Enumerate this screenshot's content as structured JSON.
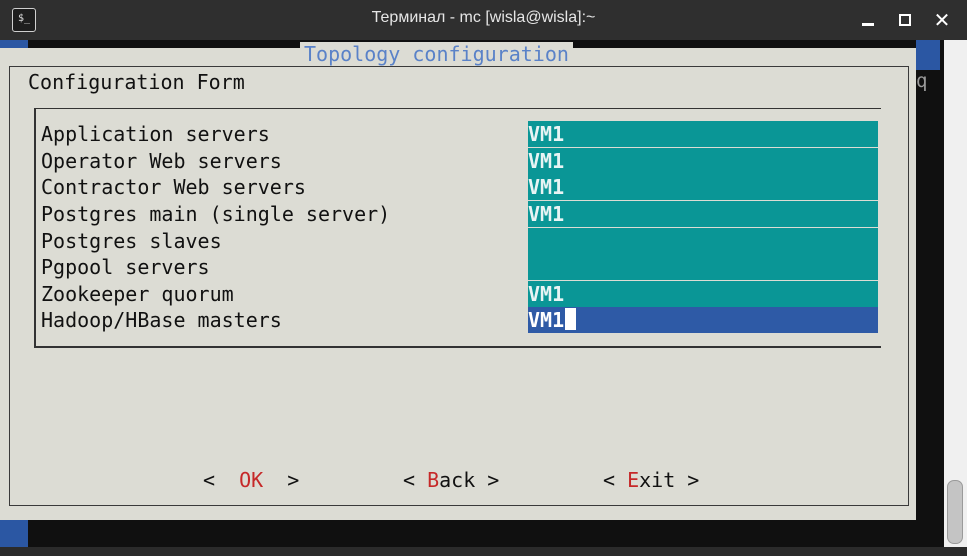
{
  "window": {
    "title": "Терминал - mc [wisla@wisla]:~",
    "icon": "terminal-icon",
    "controls": [
      "minimize-icon",
      "maximize-icon",
      "close-icon"
    ],
    "close_glyph": "✕"
  },
  "terminal": {
    "edge_char": "q"
  },
  "dialog": {
    "title": "Topology configuration",
    "heading": "Configuration Form",
    "fields": [
      {
        "label": "Application servers",
        "value": "VM1"
      },
      {
        "label": "Operator Web servers",
        "value": "VM1"
      },
      {
        "label": "Contractor Web servers",
        "value": "VM1"
      },
      {
        "label": "Postgres main (single server)",
        "value": "VM1"
      },
      {
        "label": "Postgres slaves",
        "value": ""
      },
      {
        "label": "Pgpool servers",
        "value": ""
      },
      {
        "label": "Zookeeper quorum",
        "value": "VM1"
      },
      {
        "label": "Hadoop/HBase masters",
        "value": "VM1"
      }
    ],
    "active_field_index": 7,
    "buttons": [
      {
        "open": "<  ",
        "hotkey": "O",
        "rest": "K",
        "close": "  >"
      },
      {
        "open": "< ",
        "hotkey": "B",
        "rest": "ack",
        "close": " >"
      },
      {
        "open": "< ",
        "hotkey": "E",
        "rest": "xit",
        "close": " >"
      }
    ]
  },
  "colors": {
    "dialog_bg": "#dcdcd4",
    "field_bg": "#0a9696",
    "active_field_bg": "#2e5aa6",
    "title_color": "#5a82c8",
    "hotkey_color": "#c62828"
  }
}
